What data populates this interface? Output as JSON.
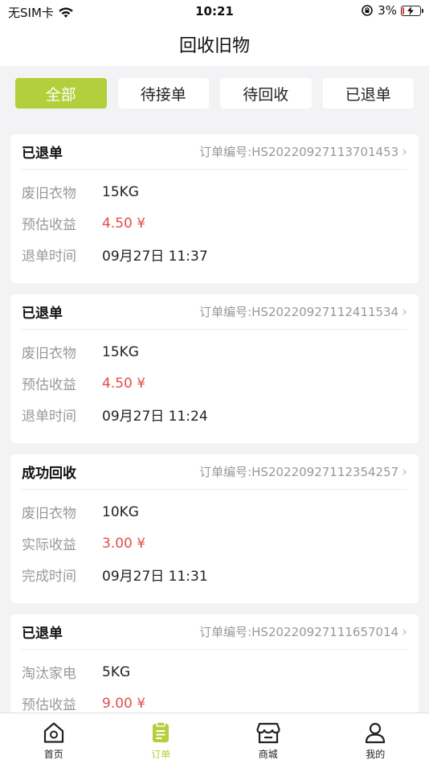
{
  "status_bar": {
    "carrier": "无SIM卡",
    "time": "10:21",
    "battery": "3%",
    "battery_level": 0.03
  },
  "nav": {
    "title": "回收旧物"
  },
  "tabs": [
    {
      "label": "全部",
      "active": true
    },
    {
      "label": "待接单",
      "active": false
    },
    {
      "label": "待回收",
      "active": false
    },
    {
      "label": "已退单",
      "active": false
    }
  ],
  "orders": [
    {
      "status": "已退单",
      "order_no": "订单编号:HS20220927113701453",
      "rows": [
        {
          "label": "废旧衣物",
          "value": "15KG"
        },
        {
          "label": "预估收益",
          "value": "4.50 ¥"
        },
        {
          "label": "退单时间",
          "value": "09月27日  11:37"
        }
      ]
    },
    {
      "status": "已退单",
      "order_no": "订单编号:HS20220927112411534",
      "rows": [
        {
          "label": "废旧衣物",
          "value": "15KG"
        },
        {
          "label": "预估收益",
          "value": "4.50 ¥"
        },
        {
          "label": "退单时间",
          "value": "09月27日  11:24"
        }
      ]
    },
    {
      "status": "成功回收",
      "order_no": "订单编号:HS20220927112354257",
      "rows": [
        {
          "label": "废旧衣物",
          "value": "10KG"
        },
        {
          "label": "实际收益",
          "value": "3.00 ¥"
        },
        {
          "label": "完成时间",
          "value": "09月27日  11:31"
        }
      ]
    },
    {
      "status": "已退单",
      "order_no": "订单编号:HS20220927111657014",
      "rows": [
        {
          "label": "淘汰家电",
          "value": "5KG"
        },
        {
          "label": "预估收益",
          "value": "9.00 ¥"
        }
      ]
    }
  ],
  "tab_bar": [
    {
      "label": "首页",
      "icon": "home-icon",
      "active": false
    },
    {
      "label": "订单",
      "icon": "order-icon",
      "active": true
    },
    {
      "label": "商城",
      "icon": "store-icon",
      "active": false
    },
    {
      "label": "我的",
      "icon": "profile-icon",
      "active": false
    }
  ],
  "colors": {
    "accent": "#b3cf3b",
    "price_red": "#e64b4b"
  }
}
